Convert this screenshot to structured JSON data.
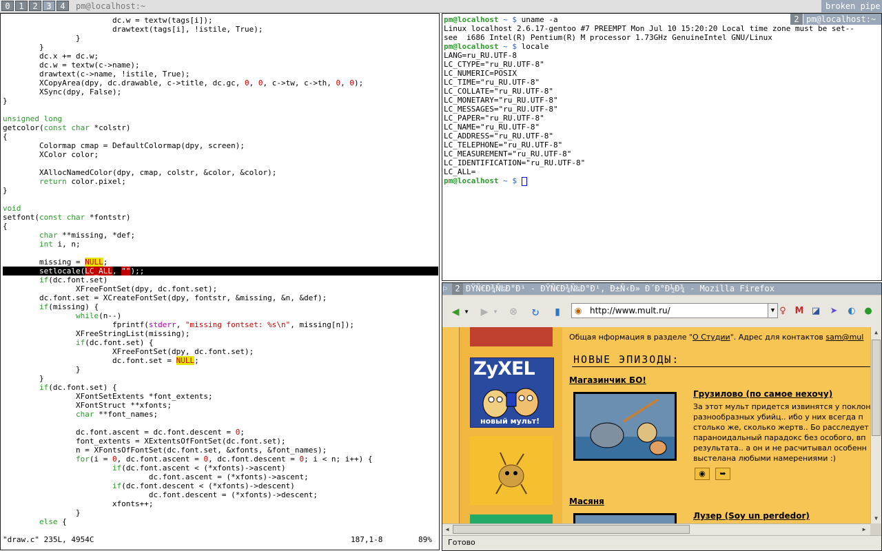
{
  "topbar": {
    "tags": [
      "0",
      "1",
      "2",
      "3",
      "4"
    ],
    "active_tag": "3",
    "window_title": "pm@localhost:~",
    "status": "broken pipe"
  },
  "vim": {
    "lines": [
      "                        dc.w = textw(tags[i]);",
      "                        drawtext(tags[i], !istile, True);",
      "                }",
      "        }",
      "        dc.x += dc.w;",
      "        dc.w = textw(c->name);",
      "        drawtext(c->name, !istile, True);",
      "        XCopyArea(dpy, dc.drawable, c->title, dc.gc, 0, 0, c->tw, c->th, 0, 0);",
      "        XSync(dpy, False);",
      "}",
      "",
      "unsigned long",
      "getcolor(const char *colstr)",
      "{",
      "        Colormap cmap = DefaultColormap(dpy, screen);",
      "        XColor color;",
      "",
      "        XAllocNamedColor(dpy, cmap, colstr, &color, &color);",
      "        return color.pixel;",
      "}",
      "",
      "void",
      "setfont(const char *fontstr)",
      "{",
      "        char **missing, *def;",
      "        int i, n;",
      "",
      "        missing = NULL;",
      "        setlocale(LC_ALL, \"\");",
      "        if(dc.font.set)",
      "                XFreeFontSet(dpy, dc.font.set);",
      "        dc.font.set = XCreateFontSet(dpy, fontstr, &missing, &n, &def);",
      "        if(missing) {",
      "                while(n--)",
      "                        fprintf(stderr, \"missing fontset: %s\\n\", missing[n]);",
      "                XFreeStringList(missing);",
      "                if(dc.font.set) {",
      "                        XFreeFontSet(dpy, dc.font.set);",
      "                        dc.font.set = NULL;",
      "                }",
      "        }",
      "        if(dc.font.set) {",
      "                XFontSetExtents *font_extents;",
      "                XFontStruct **xfonts;",
      "                char **font_names;",
      "",
      "                dc.font.ascent = dc.font.descent = 0;",
      "                font_extents = XExtentsOfFontSet(dc.font.set);",
      "                n = XFontsOfFontSet(dc.font.set, &xfonts, &font_names);",
      "                for(i = 0, dc.font.ascent = 0, dc.font.descent = 0; i < n; i++) {",
      "                        if(dc.font.ascent < (*xfonts)->ascent)",
      "                                dc.font.ascent = (*xfonts)->ascent;",
      "                        if(dc.font.descent < (*xfonts)->descent)",
      "                                dc.font.descent = (*xfonts)->descent;",
      "                        xfonts++;",
      "                }",
      "        else {"
    ],
    "status_file": "\"draw.c\" 235L, 4954C",
    "position": "187,1-8",
    "percent": "89%"
  },
  "terminal": {
    "tab_num": "2",
    "tab_title": "pm@localhost:~",
    "prompt_user": "pm@localhost",
    "prompt_rest": " ~ $ ",
    "cmd1": "uname -a",
    "out1": [
      "Linux localhost 2.6.17-gentoo #7 PREEMPT Mon Jul 10 15:20:20 Local time zone must be set--",
      "see  i686 Intel(R) Pentium(R) M processor 1.73GHz GenuineIntel GNU/Linux"
    ],
    "cmd2": "locale",
    "out2": [
      "LANG=ru_RU.UTF-8",
      "LC_CTYPE=\"ru_RU.UTF-8\"",
      "LC_NUMERIC=POSIX",
      "LC_TIME=\"ru_RU.UTF-8\"",
      "LC_COLLATE=\"ru_RU.UTF-8\"",
      "LC_MONETARY=\"ru_RU.UTF-8\"",
      "LC_MESSAGES=\"ru_RU.UTF-8\"",
      "LC_PAPER=\"ru_RU.UTF-8\"",
      "LC_NAME=\"ru_RU.UTF-8\"",
      "LC_ADDRESS=\"ru_RU.UTF-8\"",
      "LC_TELEPHONE=\"ru_RU.UTF-8\"",
      "LC_MEASUREMENT=\"ru_RU.UTF-8\"",
      "LC_IDENTIFICATION=\"ru_RU.UTF-8\"",
      "LC_ALL="
    ]
  },
  "firefox": {
    "tab_num": "2",
    "title": "ÐŸÑ€Ð¾Ñ‰Ð°Ð¹ - ÐŸÑ€Ð¾Ñ‰Ð°Ð¹, Ð±Ñ‹Ð» Ð´Ð°Ð½Ð¾ - Mozilla Firefox",
    "url": "http://www.mult.ru/",
    "status": "Готово",
    "page": {
      "info_prefix": "Общая нформация в разделе \"",
      "info_link": "О Студии",
      "info_mid": "\". Адрес для контактов ",
      "info_email": "sam@mul",
      "new_episodes": "НОВЫЕ ЭПИЗОДЫ:",
      "shop": "Магазинчик БО!",
      "ep1_title": "Грузилово (по самое нехочу)",
      "ep1_text": [
        "За этот мульт придется извинятся у поклон",
        "разнообразных убийц.. ибо у них всегда п",
        "столько же, сколько жертв.. Бо расследует",
        "параноидальный парадокс без особого, вп",
        "результата.. а он и не расчитывал особенн",
        "выстелана любыми намерениями :)"
      ],
      "masyanya": "Масяня",
      "ep2_title": "Лузер (Soy un perdedor)",
      "zyxel": "ZyXEL",
      "zyxel_caption": "новый мульт!"
    }
  }
}
